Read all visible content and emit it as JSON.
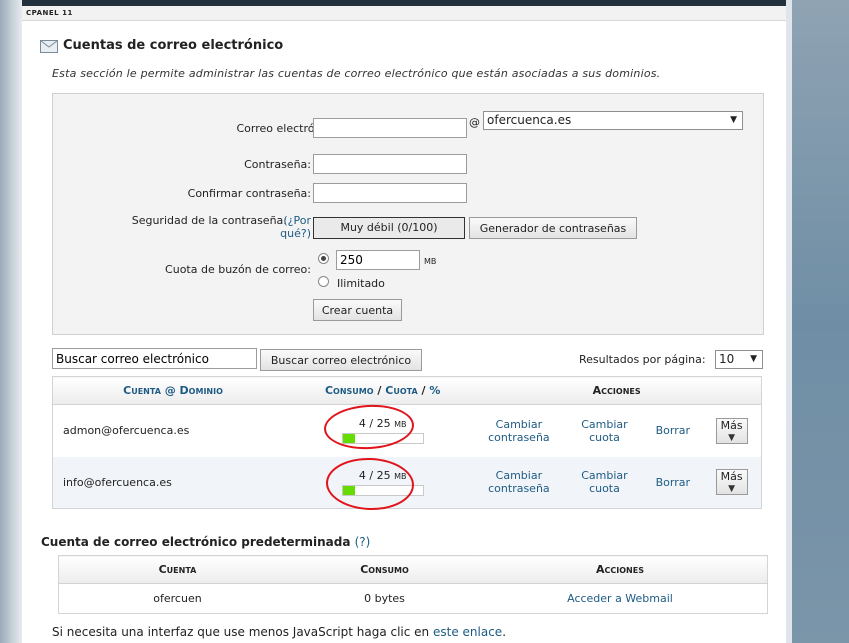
{
  "header": {
    "cpanel_label": "CPANEL 11"
  },
  "page": {
    "title": "Cuentas de correo electrónico",
    "description": "Esta sección le permite administrar las cuentas de correo electrónico que están asociadas a sus dominios."
  },
  "form": {
    "email_label": "Correo electrónico:",
    "email_value": "",
    "at_symbol": "@",
    "domain_selected": "ofercuenca.es",
    "password_label": "Contraseña:",
    "confirm_label": "Confirmar contraseña:",
    "strength_label": "Seguridad de la contraseña:",
    "strength_why_line1": "(¿Por",
    "strength_why_line2": "qué?)",
    "strength_value": "Muy débil (0/100)",
    "generator_button": "Generador de contraseñas",
    "quota_label": "Cuota de buzón de correo:",
    "quota_value": "250",
    "quota_unit": "MB",
    "unlimited_label": "Ilimitado",
    "create_button": "Crear cuenta"
  },
  "search": {
    "input_value": "Buscar correo electrónico",
    "button_label": "Buscar correo electrónico",
    "per_page_label": "Resultados por página:",
    "per_page_value": "10"
  },
  "accounts_table": {
    "col_account": "Cuenta @ Dominio",
    "col_usage_1": "Consumo",
    "col_usage_sep1": " / ",
    "col_usage_2": "Cuota",
    "col_usage_sep2": " / ",
    "col_usage_3": "%",
    "col_actions": "Acciones",
    "rows": [
      {
        "account": "admon@ofercuenca.es",
        "usage": "4 / 25",
        "unit": "MB",
        "fill_percent": 16,
        "change_password_1": "Cambiar",
        "change_password_2": "contraseña",
        "change_quota_1": "Cambiar",
        "change_quota_2": "cuota",
        "delete": "Borrar",
        "more": "Más"
      },
      {
        "account": "info@ofercuenca.es",
        "usage": "4 / 25",
        "unit": "MB",
        "fill_percent": 16,
        "change_password_1": "Cambiar",
        "change_password_2": "contraseña",
        "change_quota_1": "Cambiar",
        "change_quota_2": "cuota",
        "delete": "Borrar",
        "more": "Más"
      }
    ]
  },
  "default_account": {
    "title": "Cuenta de correo electrónico predeterminada",
    "help": "(?)",
    "col_account": "Cuenta",
    "col_usage": "Consumo",
    "col_actions": "Acciones",
    "account": "ofercuen",
    "usage": "0 bytes",
    "action_link": "Acceder a Webmail"
  },
  "footer": {
    "text": "Si necesita una interfaz que use menos JavaScript haga clic en ",
    "link": "este enlace",
    "period": "."
  },
  "colors": {
    "link": "#1e5b84",
    "usage_fill": "#66dd00",
    "annotation": "#e0141a",
    "topbar": "#23313d"
  }
}
